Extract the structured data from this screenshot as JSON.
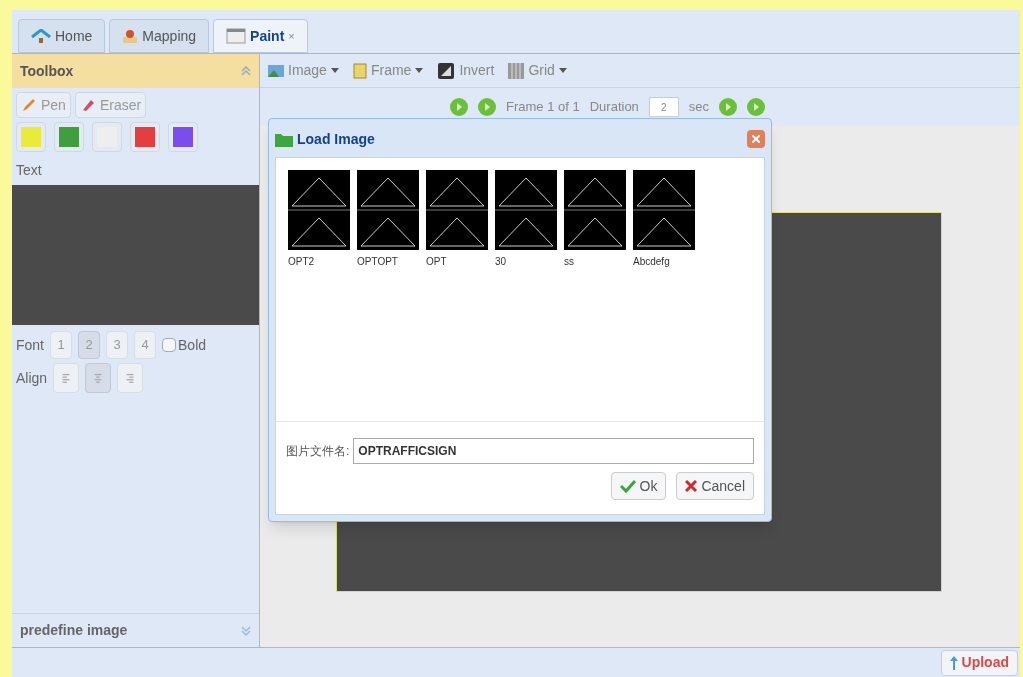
{
  "tabs": [
    {
      "label": "Home",
      "selected": false
    },
    {
      "label": "Mapping",
      "selected": false
    },
    {
      "label": "Paint",
      "selected": true,
      "close": "×"
    }
  ],
  "toolbox": {
    "title": "Toolbox",
    "tools": [
      {
        "label": "Pen",
        "selected": false
      },
      {
        "label": "Eraser",
        "selected": false
      }
    ],
    "colors": [
      {
        "color": "#eaea3a"
      },
      {
        "color": "#3f9f3f"
      },
      {
        "color": "#eeeeee"
      },
      {
        "color": "#e53e3e"
      },
      {
        "color": "#7c4dea"
      }
    ],
    "text_label": "Text",
    "font_label": "Font",
    "fonts": [
      {
        "label": "1",
        "selected": false
      },
      {
        "label": "2",
        "selected": true
      },
      {
        "label": "3",
        "selected": false
      },
      {
        "label": "4",
        "selected": false
      }
    ],
    "bold": {
      "label": "Bold",
      "checked": false
    },
    "align_label": "Align",
    "aligns": [
      {
        "kind": "left",
        "selected": false
      },
      {
        "kind": "center",
        "selected": true
      },
      {
        "kind": "right",
        "selected": false
      }
    ],
    "footer": "predefine image"
  },
  "toolbar": [
    {
      "label": "Image",
      "dropdown": true
    },
    {
      "label": "Frame",
      "dropdown": true
    },
    {
      "label": "Invert",
      "dropdown": false
    },
    {
      "label": "Grid",
      "dropdown": true
    }
  ],
  "frame_bar": {
    "frame": "Frame 1 of 1",
    "duration_label": "Duration",
    "duration": "2",
    "unit": "sec"
  },
  "dialog": {
    "title": "Load Image",
    "images": [
      {
        "name": "OPT2"
      },
      {
        "name": "OPTOPT"
      },
      {
        "name": "OPT"
      },
      {
        "name": "30"
      },
      {
        "name": "ss"
      },
      {
        "name": "Abcdefg"
      }
    ],
    "filename_label": "图片文件名:",
    "filename": "OPTRAFFICSIGN",
    "ok": "Ok",
    "cancel": "Cancel"
  },
  "status_bar": {
    "upload": "Upload"
  }
}
